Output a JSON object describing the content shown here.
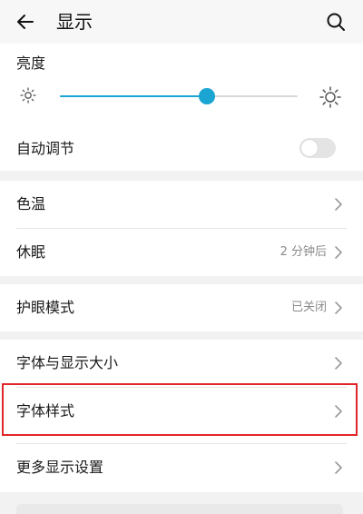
{
  "header": {
    "title": "显示"
  },
  "brightness": {
    "label": "亮度",
    "level": 0.62,
    "auto_label": "自动调节",
    "auto_enabled": false
  },
  "color_group": {
    "items": [
      {
        "label": "色温",
        "value": ""
      },
      {
        "label": "休眠",
        "value": "2 分钟后"
      }
    ]
  },
  "eye_group": {
    "items": [
      {
        "label": "护眼模式",
        "value": "已关闭"
      }
    ]
  },
  "font_group": {
    "items": [
      {
        "label": "字体与显示大小",
        "value": ""
      },
      {
        "label": "字体样式",
        "value": ""
      },
      {
        "label": "更多显示设置",
        "value": ""
      }
    ]
  },
  "colors": {
    "accent": "#1aa5d2",
    "highlight": "#e0262a",
    "background": "#f2f2f2"
  }
}
